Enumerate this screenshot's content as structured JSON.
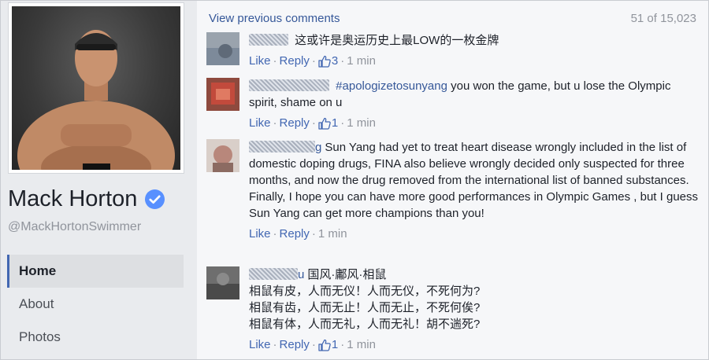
{
  "profile": {
    "name": "Mack Horton",
    "handle": "@MackHortonSwimmer"
  },
  "nav": {
    "items": [
      {
        "label": "Home",
        "active": true
      },
      {
        "label": "About",
        "active": false
      },
      {
        "label": "Photos",
        "active": false
      }
    ]
  },
  "comments_header": {
    "view_previous": "View previous comments",
    "count": "51 of 15,023"
  },
  "comments": [
    {
      "tag": "",
      "text": "这或许是奥运历史上最LOW的一枚金牌",
      "like_label": "Like",
      "reply_label": "Reply",
      "likes": "3",
      "time": "1 min"
    },
    {
      "tag": "#apologizetosunyang",
      "text": " you won the game, but u lose the Olympic spirit, shame on u",
      "like_label": "Like",
      "reply_label": "Reply",
      "likes": "1",
      "time": "1 min"
    },
    {
      "name_suffix": "g",
      "tag": "",
      "text": "Sun Yang had yet to treat heart disease wrongly included in the list of domestic doping drugs, FINA also believe wrongly decided only suspected for three months, and now the drug removed from the international list of banned substances. Finally, I hope you can have more good performances in Olympic Games , but I guess Sun Yang can get more champions than you!",
      "like_label": "Like",
      "reply_label": "Reply",
      "likes": "",
      "time": "1 min"
    },
    {
      "name_suffix": "u",
      "tag": "",
      "text": "国风·鄘风·相鼠",
      "lines": [
        "相鼠有皮，人而无仪！人而无仪，不死何为?",
        "相鼠有齿，人而无止！人而无止，不死何俟?",
        "相鼠有体，人而无礼，人而无礼！胡不遄死?"
      ],
      "like_label": "Like",
      "reply_label": "Reply",
      "likes": "1",
      "time": "1 min"
    }
  ],
  "colors": {
    "link": "#4267b2",
    "muted": "#90949c",
    "verified": "#5890ff"
  },
  "icons": [
    "verified-badge-icon",
    "thumbs-up-icon"
  ]
}
